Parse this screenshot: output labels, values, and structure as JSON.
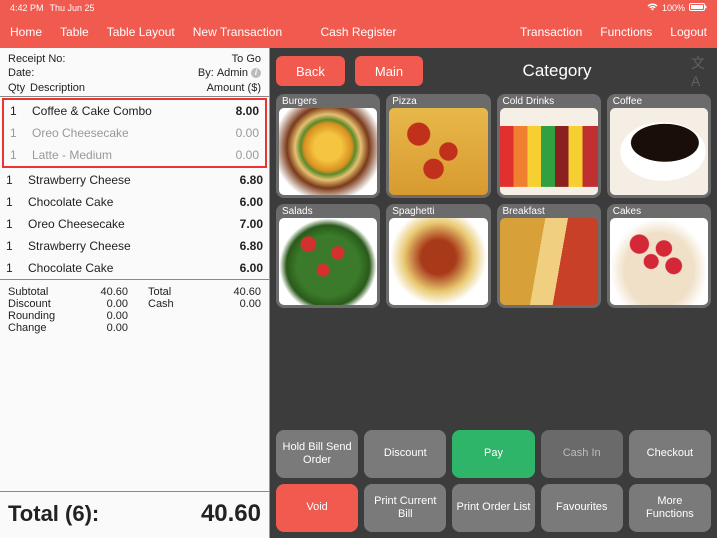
{
  "status": {
    "time": "4:42 PM",
    "date": "Thu Jun 25",
    "battery": "100%"
  },
  "nav": {
    "left": [
      "Home",
      "Table",
      "Table Layout",
      "New Transaction"
    ],
    "center": "Cash Register",
    "right": [
      "Transaction",
      "Functions",
      "Logout"
    ]
  },
  "receipt": {
    "header": {
      "receipt_no_label": "Receipt No:",
      "togo": "To Go",
      "date_label": "Date:",
      "by_label": "By:",
      "by_value": "Admin"
    },
    "cols": {
      "qty": "Qty",
      "desc": "Description",
      "amt": "Amount ($)"
    },
    "combo": {
      "parent": {
        "qty": "1",
        "desc": "Coffee & Cake Combo",
        "amt": "8.00"
      },
      "children": [
        {
          "qty": "1",
          "desc": "Oreo Cheesecake",
          "amt": "0.00"
        },
        {
          "qty": "1",
          "desc": "Latte - Medium",
          "amt": "0.00"
        }
      ]
    },
    "lines": [
      {
        "qty": "1",
        "desc": "Strawberry Cheese",
        "amt": "6.80"
      },
      {
        "qty": "1",
        "desc": "Chocolate Cake",
        "amt": "6.00"
      },
      {
        "qty": "1",
        "desc": "Oreo Cheesecake",
        "amt": "7.00"
      },
      {
        "qty": "1",
        "desc": "Strawberry Cheese",
        "amt": "6.80"
      },
      {
        "qty": "1",
        "desc": "Chocolate Cake",
        "amt": "6.00"
      }
    ],
    "totals": {
      "subtotal_l": "Subtotal",
      "subtotal_v": "40.60",
      "total_l": "Total",
      "total_v": "40.60",
      "discount_l": "Discount",
      "discount_v": "0.00",
      "cash_l": "Cash",
      "cash_v": "0.00",
      "rounding_l": "Rounding",
      "rounding_v": "0.00",
      "change_l": "Change",
      "change_v": "0.00"
    },
    "grand": {
      "label": "Total (6):",
      "value": "40.60"
    }
  },
  "top_buttons": {
    "back": "Back",
    "main": "Main"
  },
  "category_title": "Category",
  "categories": [
    "Burgers",
    "Pizza",
    "Cold Drinks",
    "Coffee",
    "Salads",
    "Spaghetti",
    "Breakfast",
    "Cakes"
  ],
  "actions": {
    "hold": "Hold Bill Send Order",
    "discount": "Discount",
    "pay": "Pay",
    "cashin": "Cash In",
    "checkout": "Checkout",
    "void": "Void",
    "print_current": "Print Current Bill",
    "print_order": "Print Order List",
    "favourites": "Favourites",
    "more": "More Functions"
  }
}
